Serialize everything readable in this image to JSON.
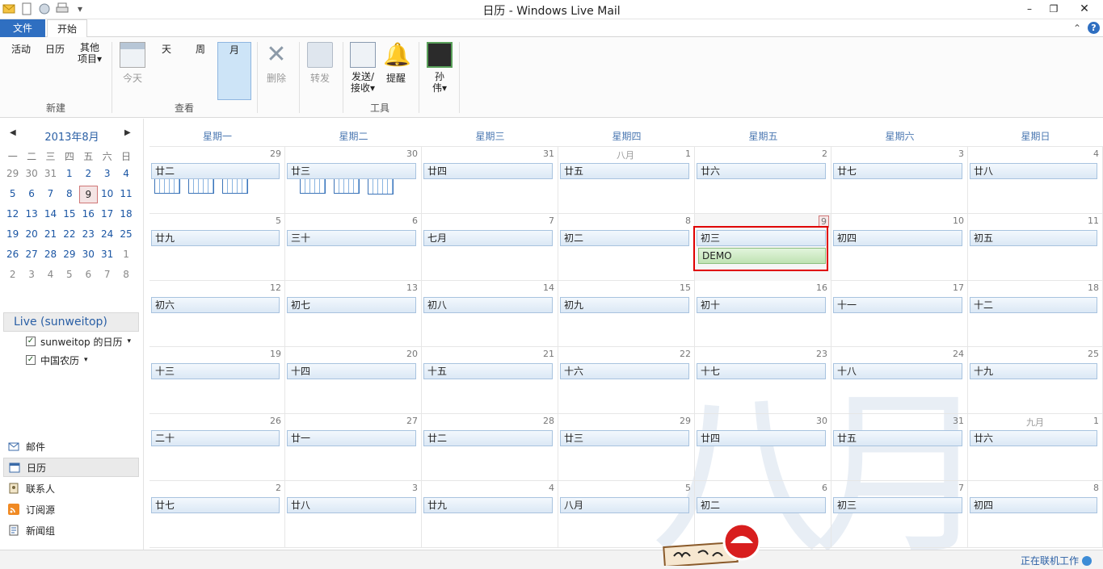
{
  "window": {
    "title": "日历 - Windows Live Mail"
  },
  "ribbon": {
    "tabs": {
      "file": "文件",
      "home": "开始"
    },
    "buttons": {
      "activity": "活动",
      "calendar": "日历",
      "other_items_1": "其他",
      "other_items_2": "项目",
      "today": "今天",
      "day": "天",
      "week": "周",
      "month": "月",
      "delete": "删除",
      "forward": "转发",
      "send_receive_1": "发送/",
      "send_receive_2": "接收",
      "reminder": "提醒",
      "user_1": "孙",
      "user_2": "伟"
    },
    "groups": {
      "new": "新建",
      "view": "查看",
      "tools": "工具"
    }
  },
  "mini_calendar": {
    "title": "2013年8月",
    "weekdays": [
      "一",
      "二",
      "三",
      "四",
      "五",
      "六",
      "日"
    ],
    "weeks": [
      [
        "29",
        "30",
        "31",
        "1",
        "2",
        "3",
        "4"
      ],
      [
        "5",
        "6",
        "7",
        "8",
        "9",
        "10",
        "11"
      ],
      [
        "12",
        "13",
        "14",
        "15",
        "16",
        "17",
        "18"
      ],
      [
        "19",
        "20",
        "21",
        "22",
        "23",
        "24",
        "25"
      ],
      [
        "26",
        "27",
        "28",
        "29",
        "30",
        "31",
        "1"
      ],
      [
        "2",
        "3",
        "4",
        "5",
        "6",
        "7",
        "8"
      ]
    ],
    "today": "9"
  },
  "accounts": {
    "name": "Live (sunweitop)",
    "calendars": [
      "sunweitop 的日历",
      "中国农历"
    ]
  },
  "nav": {
    "mail": "邮件",
    "calendar": "日历",
    "contacts": "联系人",
    "feeds": "订阅源",
    "newsgroups": "新闻组"
  },
  "month_view": {
    "weekdays": [
      "星期一",
      "星期二",
      "星期三",
      "星期四",
      "星期五",
      "星期六",
      "星期日"
    ],
    "month_labels": {
      "aug": "八月",
      "sep": "九月"
    },
    "weeks": [
      [
        {
          "d": "29",
          "l": "廿二"
        },
        {
          "d": "30",
          "l": "廿三"
        },
        {
          "d": "31",
          "l": "廿四"
        },
        {
          "d": "1",
          "l": "廿五"
        },
        {
          "d": "2",
          "l": "廿六"
        },
        {
          "d": "3",
          "l": "廿七"
        },
        {
          "d": "4",
          "l": "廿八"
        }
      ],
      [
        {
          "d": "5",
          "l": "廿九"
        },
        {
          "d": "6",
          "l": "三十"
        },
        {
          "d": "7",
          "l": "七月"
        },
        {
          "d": "8",
          "l": "初二"
        },
        {
          "d": "9",
          "l": "初三"
        },
        {
          "d": "10",
          "l": "初四"
        },
        {
          "d": "11",
          "l": "初五"
        }
      ],
      [
        {
          "d": "12",
          "l": "初六"
        },
        {
          "d": "13",
          "l": "初七"
        },
        {
          "d": "14",
          "l": "初八"
        },
        {
          "d": "15",
          "l": "初九"
        },
        {
          "d": "16",
          "l": "初十"
        },
        {
          "d": "17",
          "l": "十一"
        },
        {
          "d": "18",
          "l": "十二"
        }
      ],
      [
        {
          "d": "19",
          "l": "十三"
        },
        {
          "d": "20",
          "l": "十四"
        },
        {
          "d": "21",
          "l": "十五"
        },
        {
          "d": "22",
          "l": "十六"
        },
        {
          "d": "23",
          "l": "十七"
        },
        {
          "d": "24",
          "l": "十八"
        },
        {
          "d": "25",
          "l": "十九"
        }
      ],
      [
        {
          "d": "26",
          "l": "二十"
        },
        {
          "d": "27",
          "l": "廿一"
        },
        {
          "d": "28",
          "l": "廿二"
        },
        {
          "d": "29",
          "l": "廿三"
        },
        {
          "d": "30",
          "l": "廿四"
        },
        {
          "d": "31",
          "l": "廿五"
        },
        {
          "d": "1",
          "l": "廿六"
        }
      ],
      [
        {
          "d": "2",
          "l": "廿七"
        },
        {
          "d": "3",
          "l": "廿八"
        },
        {
          "d": "4",
          "l": "廿九"
        },
        {
          "d": "5",
          "l": "八月"
        },
        {
          "d": "6",
          "l": "初二"
        },
        {
          "d": "7",
          "l": "初三"
        },
        {
          "d": "8",
          "l": "初四"
        }
      ]
    ],
    "event": {
      "title": "DEMO"
    },
    "watermark": "八月"
  },
  "status": {
    "text": "正在联机工作"
  },
  "colors": {
    "accent": "#2f6fc1",
    "highlight": "#e00000",
    "event_green": "#bfe2b3"
  }
}
